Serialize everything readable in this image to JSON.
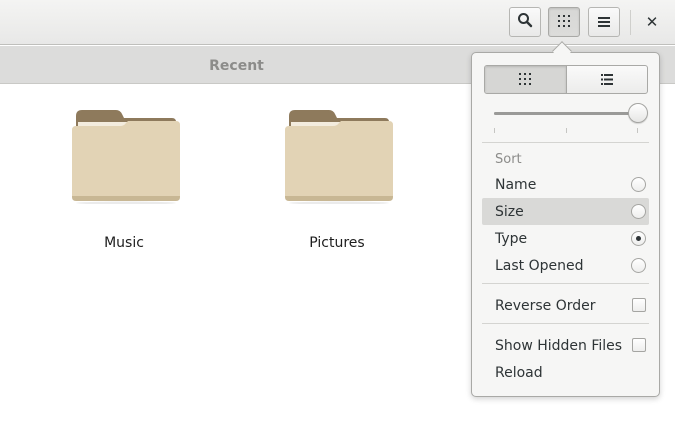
{
  "header": {
    "search_icon": "search-icon",
    "view_icon": "grid-view-icon",
    "menu_icon": "hamburger-menu-icon",
    "close_label": "✕"
  },
  "location": {
    "label": "Recent"
  },
  "files": [
    {
      "name": "Music",
      "icon": "folder-icon"
    },
    {
      "name": "Pictures",
      "icon": "folder-icon"
    }
  ],
  "popover": {
    "view_modes": [
      {
        "icon": "grid-view-icon",
        "active": true
      },
      {
        "icon": "list-view-icon",
        "active": false
      }
    ],
    "zoom_level": 1.0,
    "sort_header": "Sort",
    "sort_options": [
      {
        "label": "Name",
        "selected": false,
        "hover": false
      },
      {
        "label": "Size",
        "selected": false,
        "hover": true
      },
      {
        "label": "Type",
        "selected": true,
        "hover": false
      },
      {
        "label": "Last Opened",
        "selected": false,
        "hover": false
      }
    ],
    "reverse_order": {
      "label": "Reverse Order",
      "checked": false
    },
    "show_hidden": {
      "label": "Show Hidden Files",
      "checked": false
    },
    "reload": {
      "label": "Reload"
    }
  },
  "colors": {
    "folder_body": "#e2d3b5",
    "folder_back": "#8e7a5c",
    "accent_text": "#2e3436",
    "muted_text": "#8c8c8a"
  }
}
